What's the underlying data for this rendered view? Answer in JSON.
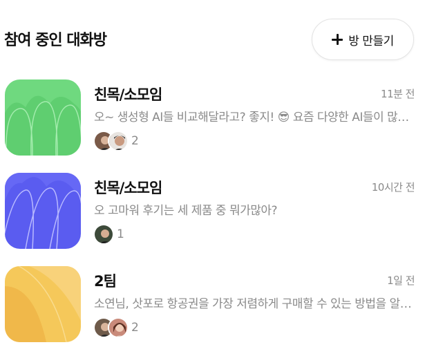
{
  "header": {
    "title": "참여 중인 대화방",
    "create_button": "방 만들기"
  },
  "rooms": [
    {
      "name": "친목/소모임",
      "time": "11분 전",
      "preview": "오~ 생성형 AI들 비교해달라고? 좋지! 😎 요즘 다양한 AI들이 많이 나왔어",
      "member_count": "2"
    },
    {
      "name": "친목/소모임",
      "time": "10시간 전",
      "preview": "오 고마워 후기는 세 제품 중 뭐가많아?",
      "member_count": "1"
    },
    {
      "name": "2팀",
      "time": "1일 전",
      "preview": "소연님, 삿포로 항공권을 가장 저렴하게 구매할 수 있는 방법을 알려드릴게요",
      "member_count": "2"
    }
  ],
  "colors": {
    "green_thumb": "#6fd97f",
    "blue_thumb": "#5a5cf0",
    "yellow_thumb": "#f5c85a",
    "muted_text": "#8a8a8a"
  }
}
